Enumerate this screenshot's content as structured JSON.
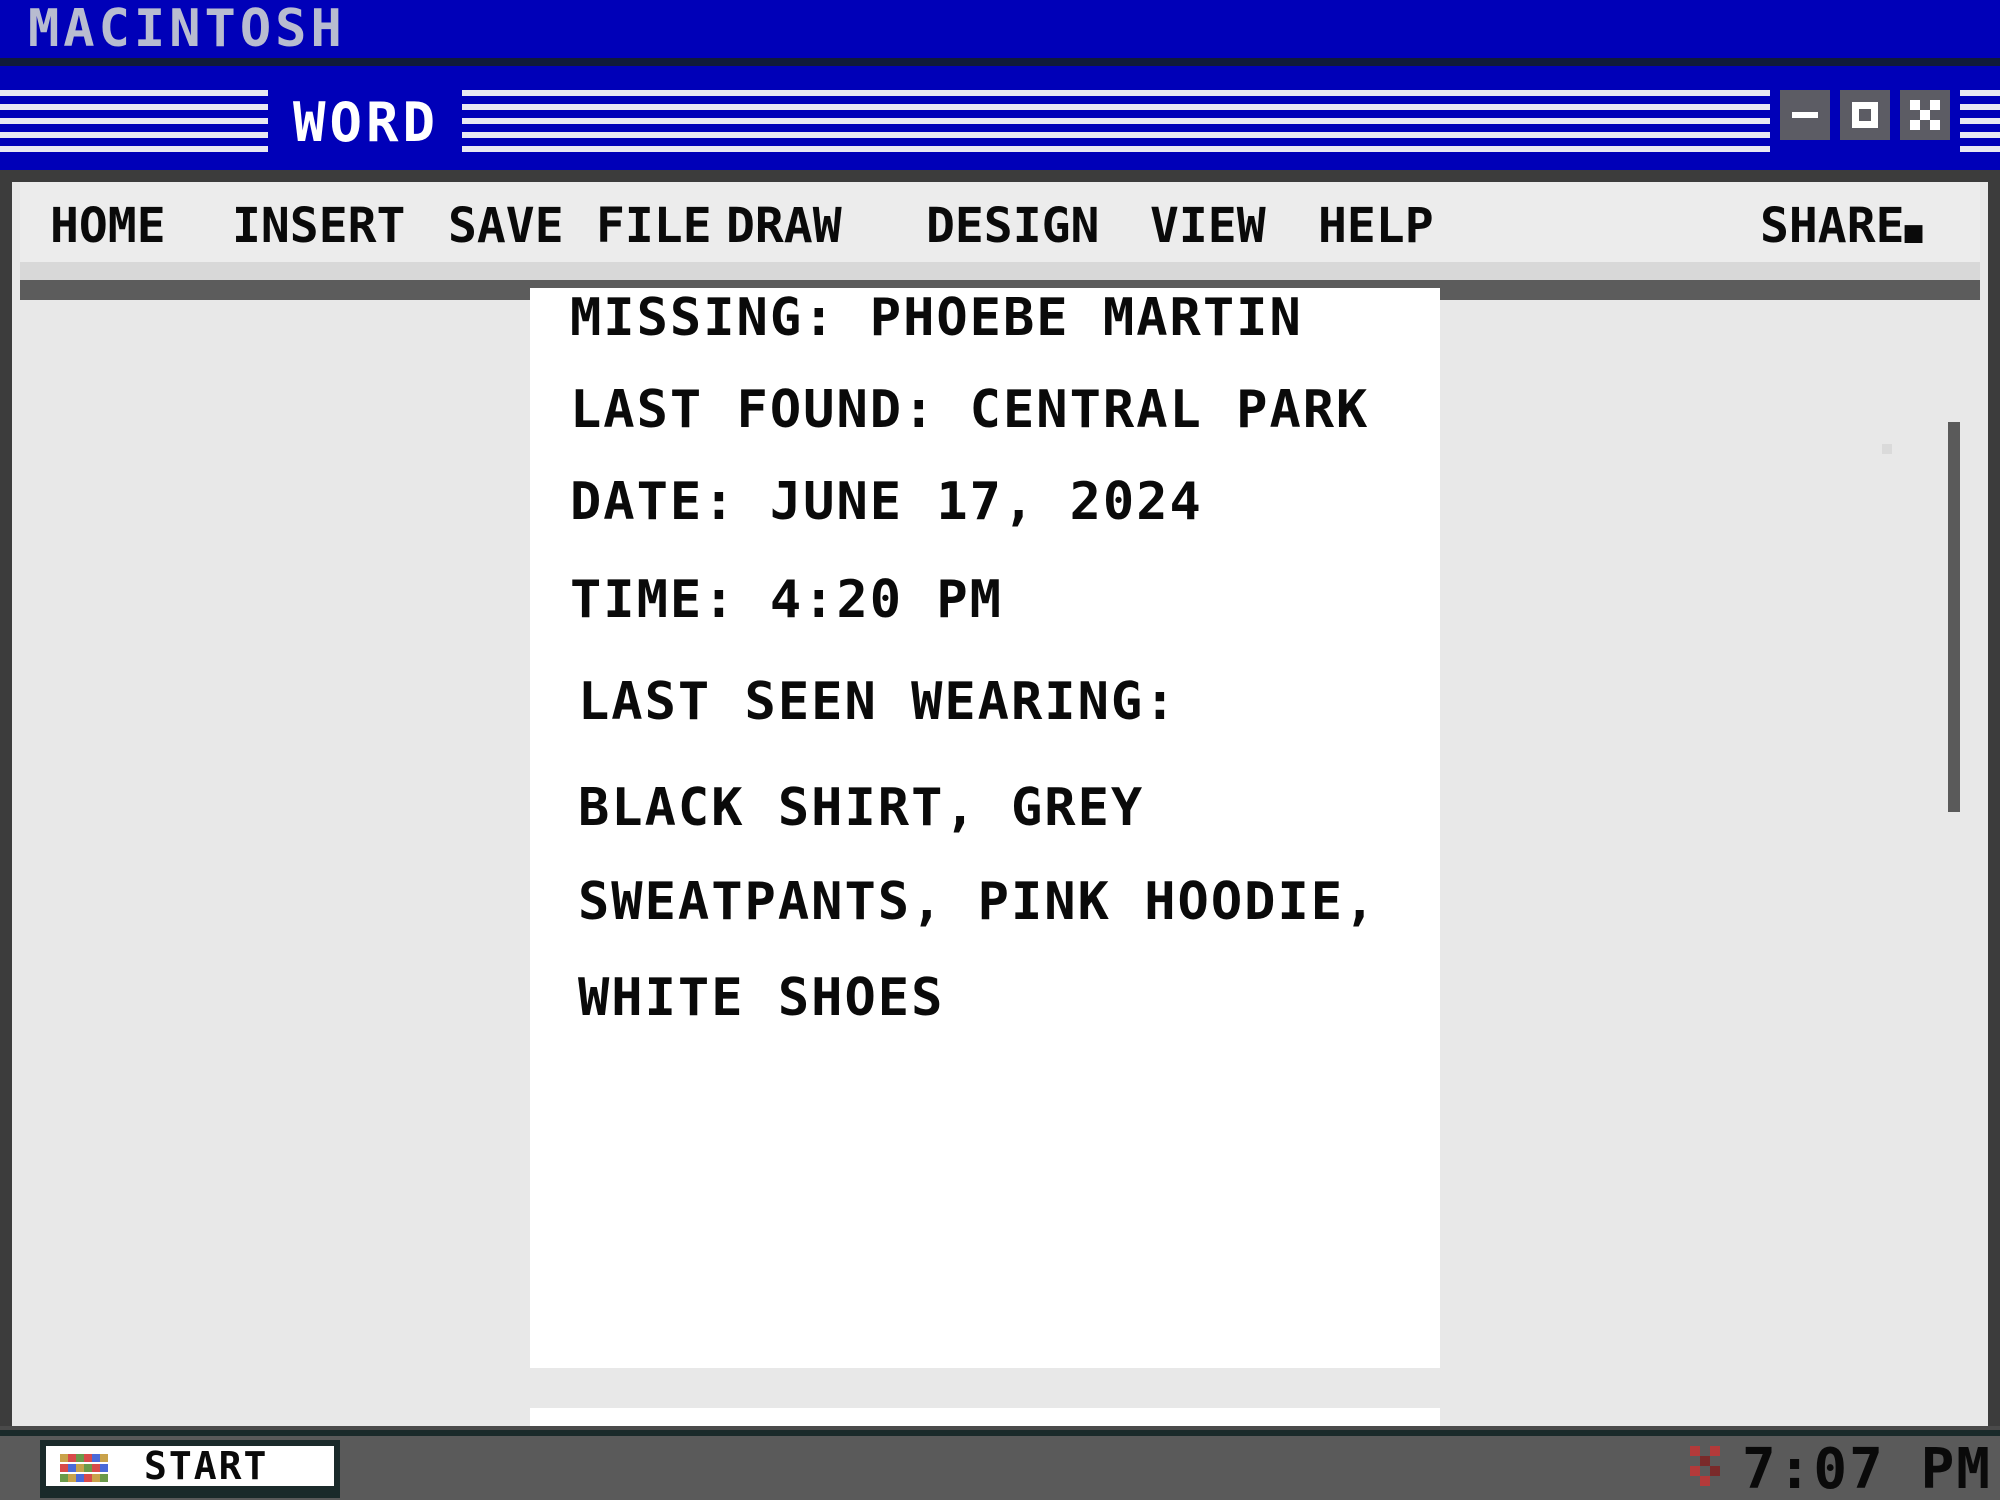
{
  "os": {
    "title": "MACINTOSH"
  },
  "window": {
    "title": "WORD",
    "controls": {
      "minimize": "minimize-icon",
      "maximize": "maximize-icon",
      "close": "close-icon"
    }
  },
  "menu": {
    "items": [
      "HOME",
      "INSERT",
      "SAVE",
      "FILE",
      "DRAW",
      "DESIGN",
      "VIEW",
      "HELP"
    ],
    "share_label": "SHARE"
  },
  "document": {
    "lines": [
      "MISSING: PHOEBE MARTIN",
      "LAST FOUND:  CENTRAL PARK",
      "DATE: JUNE 17, 2024",
      "TIME:  4:20 PM",
      "LAST SEEN WEARING:",
      "BLACK  SHIRT, GREY",
      "SWEATPANTS, PINK HOODIE,",
      "WHITE  SHOES"
    ]
  },
  "taskbar": {
    "start_label": "START",
    "clock": "7:07 PM"
  },
  "colors": {
    "os_bar": "#0000b8",
    "page": "#ffffff",
    "frame": "#3c3c3c",
    "taskbar": "#5a5a5a",
    "text": "#0a0a0a"
  }
}
